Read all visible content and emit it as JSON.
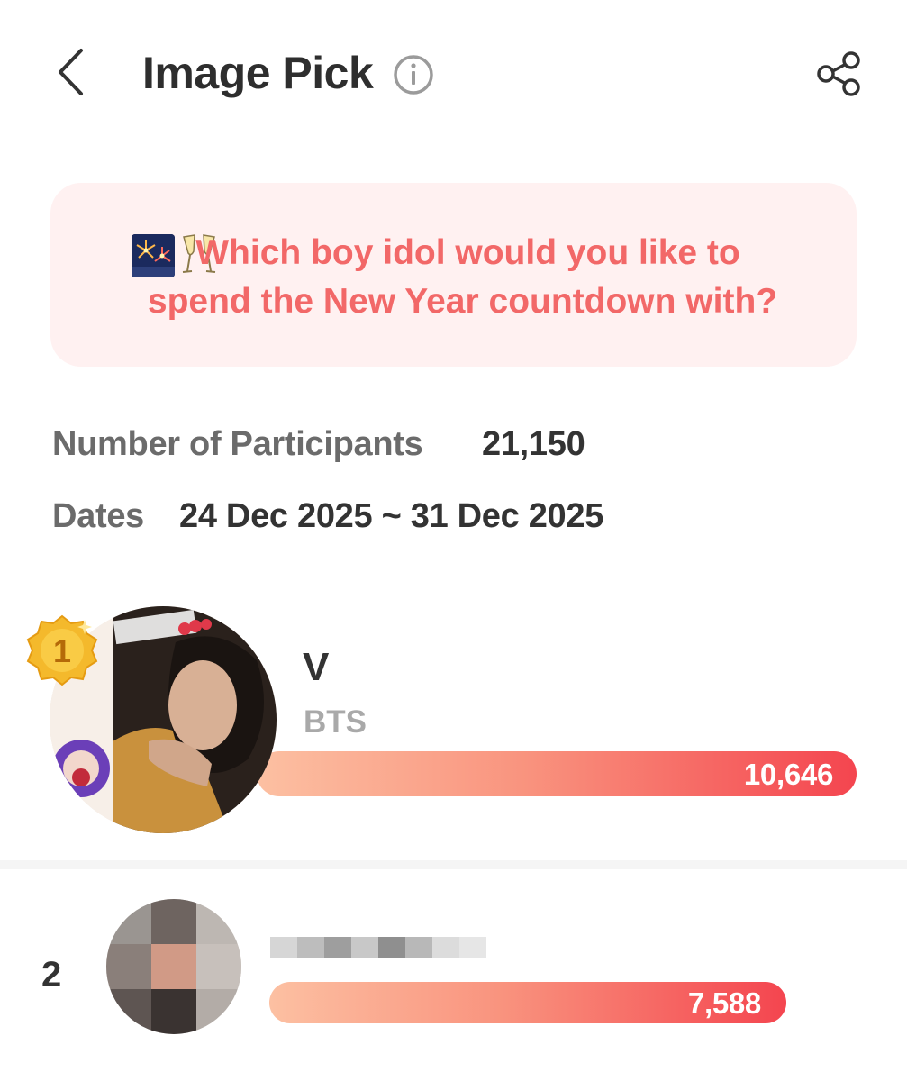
{
  "header": {
    "title": "Image Pick"
  },
  "question": {
    "line1": "Which boy idol would you like to",
    "line2": "spend the New Year countdown with?",
    "emoji_icons": [
      "fireworks-icon",
      "clinking-glasses-icon"
    ]
  },
  "meta": {
    "participants_label": "Number of Participants",
    "participants_value": "21,150",
    "dates_label": "Dates",
    "dates_value": "24 Dec 2025 ~ 31 Dec 2025"
  },
  "results": [
    {
      "rank": "1",
      "name": "V",
      "group": "BTS",
      "votes": "10,646",
      "share_of_top": 1.0
    },
    {
      "rank": "2",
      "votes": "7,588",
      "share_of_top": 0.713
    }
  ],
  "colors": {
    "accent": "#f26868",
    "banner_bg": "#fff1f1",
    "bar_start": "#fcc0a2",
    "bar_end": "#f4454f",
    "medal_gold": "#f4b92c"
  }
}
